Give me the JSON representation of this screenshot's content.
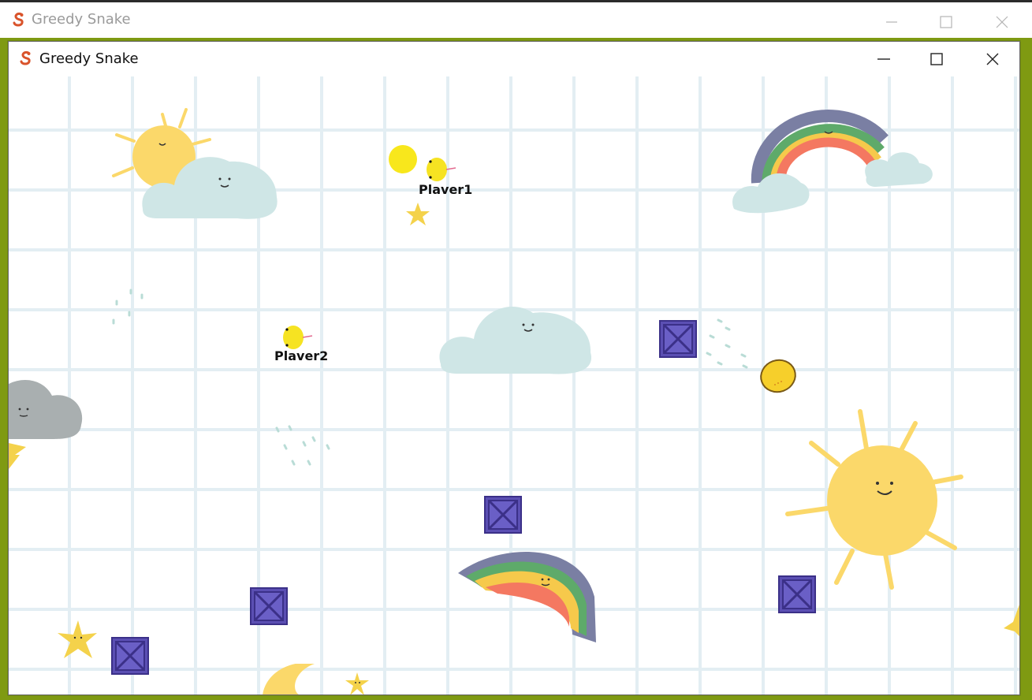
{
  "window": {
    "title": "Greedy Snake",
    "app_icon": "snake-icon",
    "controls": [
      "minimize-icon",
      "maximize-icon",
      "close-icon"
    ]
  },
  "game": {
    "players": [
      {
        "label": "Plaver1",
        "icon": "chick-snake-head-icon"
      },
      {
        "label": "Plaver2",
        "icon": "chick-snake-head-icon"
      }
    ],
    "food": [
      "yellow-ball-icon",
      "lemon-icon"
    ],
    "obstacles": [
      "crate-icon",
      "crate-icon",
      "crate-icon",
      "crate-icon",
      "crate-icon"
    ],
    "decorations": [
      "sun-icon",
      "cloud-icon",
      "rainbow-icon",
      "star-icon",
      "moon-icon",
      "rain-cloud-icon"
    ],
    "colors": {
      "frame": "#7f9a12",
      "grid_line": "#e3eef3",
      "crate": "#5b4fb3",
      "sun": "#fbd86a",
      "cloud": "#cfe6e6"
    }
  }
}
